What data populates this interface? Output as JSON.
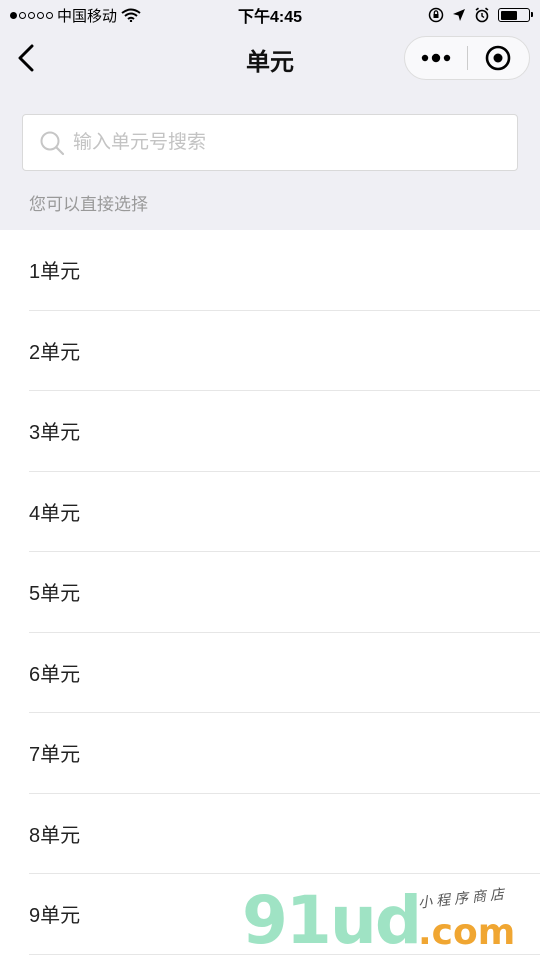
{
  "status_bar": {
    "carrier": "中国移动",
    "time": "下午4:45",
    "signal_bars_filled": 1,
    "signal_bars_total": 5,
    "battery_level": 0.62
  },
  "nav": {
    "title": "单元",
    "back_icon": "chevron-left-icon",
    "more_icon": "more-dots-icon",
    "close_icon": "target-circle-icon"
  },
  "search": {
    "placeholder": "输入单元号搜索",
    "value": ""
  },
  "hint": "您可以直接选择",
  "units": [
    {
      "label": "1单元"
    },
    {
      "label": "2单元"
    },
    {
      "label": "3单元"
    },
    {
      "label": "4单元"
    },
    {
      "label": "5单元"
    },
    {
      "label": "6单元"
    },
    {
      "label": "7单元"
    },
    {
      "label": "8单元"
    },
    {
      "label": "9单元"
    }
  ],
  "watermark": {
    "main": "91ud",
    "com": ".com",
    "tag": "小程序商店"
  },
  "colors": {
    "background": "#efeff4",
    "watermark_green": "#9fe3c4",
    "watermark_orange": "#f0a632"
  }
}
